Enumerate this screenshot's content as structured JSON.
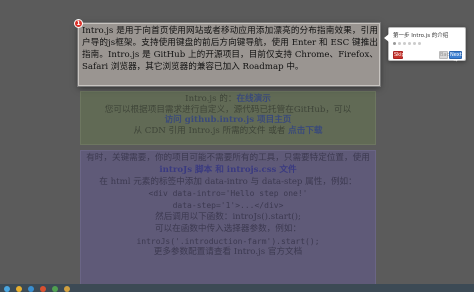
{
  "intro": {
    "step_number": "1",
    "text": "Intro.js 是用于向首页使用网站或者移动应用添加漂亮的分布指南效果，引用户导的js框架。支持使用键盘的前后方向键导航，使用 Enter 和 ESC 键推出指南。Intro.js 是 GitHub 上的开源项目，目前仅支持 Chrome、Firefox、Safari 浏览器，其它浏览器的兼容已加入 Roadmap 中。"
  },
  "green_block": {
    "line1_prefix": "Intro.js 的",
    "line1_link": "在线演示",
    "line2": "您可以根据项目需求进行自定义，源代码已托管在GitHub，可以",
    "line3_link": "访问 github.intro.js 项目主页",
    "line4_prefix": "从 CDN 引用 Intro.js 所需的文件 或者",
    "line4_link": "点击下载"
  },
  "purple_block": {
    "line1": "有时，关键需要，你的项目可能不需要所有的工具，只需要特定位置，使用",
    "line2_link": "introJs 脚本 和 introjs.css 文件",
    "line3": "在 html 元素的标签中添加 data-intro 与 data-step 属性，例如：",
    "code1": "<div data-intro='Hello step one!'",
    "code2": "data-step='1'>...</div>",
    "line4": "然后调用以下函数：introJs().start();",
    "line5": "可以在函数中传入选择器参数，例如：",
    "code3": "introJs('.introduction-farm').start();",
    "line6": "更多参数配置请查看 Intro.js 官方文档"
  },
  "tooltip": {
    "text": "第一步 Intro.js 的介绍",
    "skip_label": "Skip",
    "back_label": "Back",
    "next_label": "Next →",
    "bullet_count": 6,
    "active_bullet": 1
  },
  "colors": {
    "overlay": "#5b5b5b",
    "skip": "#c5332b",
    "next": "#3c7fd0",
    "badge": "#d9322a"
  }
}
